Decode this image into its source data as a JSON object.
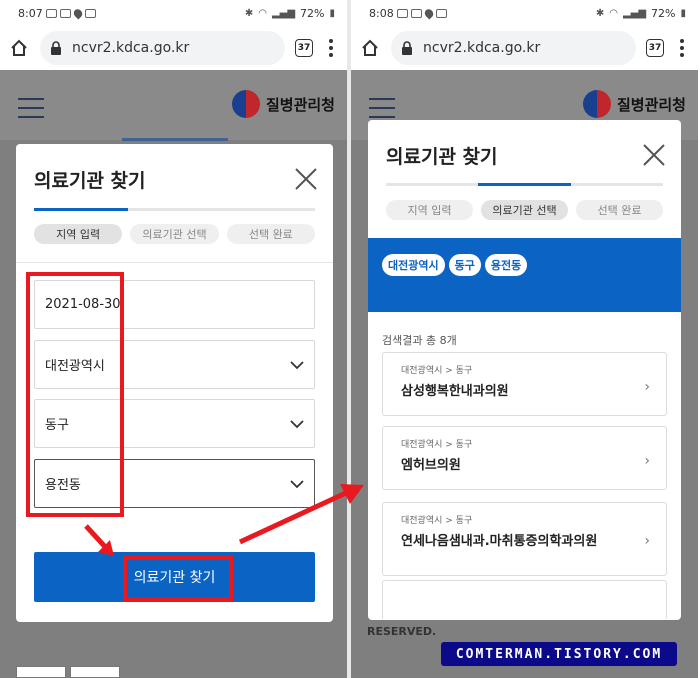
{
  "left": {
    "statusbar": {
      "time": "8:07",
      "battery": "72%"
    },
    "browser": {
      "url": "ncvr2.kdca.go.kr",
      "tab_count": "37"
    },
    "page": {
      "logo_text": "질병관리청"
    },
    "modal": {
      "title": "의료기관 찾기",
      "steps": [
        "지역 입력",
        "의료기관 선택",
        "선택 완료"
      ],
      "progress": 0.33,
      "fields": {
        "date": "2021-08-30",
        "city": "대전광역시",
        "district": "동구",
        "dong": "용전동"
      },
      "search_button": "의료기관 찾기"
    }
  },
  "right": {
    "statusbar": {
      "time": "8:08",
      "battery": "72%"
    },
    "browser": {
      "url": "ncvr2.kdca.go.kr",
      "tab_count": "37"
    },
    "page": {
      "logo_text": "질병관리청",
      "footer_text": "RESERVED."
    },
    "modal": {
      "title": "의료기관 찾기",
      "steps": [
        "지역 입력",
        "의료기관 선택",
        "선택 완료"
      ],
      "progress": 0.66,
      "chips": [
        "대전광역시",
        "동구",
        "용전동"
      ],
      "result_count": "검색결과 총 8개",
      "results": [
        {
          "region": "대전광역시 > 동구",
          "name": "삼성행복한내과의원"
        },
        {
          "region": "대전광역시 > 동구",
          "name": "엠허브의원"
        },
        {
          "region": "대전광역시 > 동구",
          "name": "연세나음샘내과.마취통증의학과의원"
        }
      ]
    }
  },
  "watermark": "COMTERMAN.TISTORY.COM",
  "colors": {
    "primary": "#0b63c4",
    "annotation_red": "#e8191f",
    "watermark_bg": "#0a0a8a"
  }
}
